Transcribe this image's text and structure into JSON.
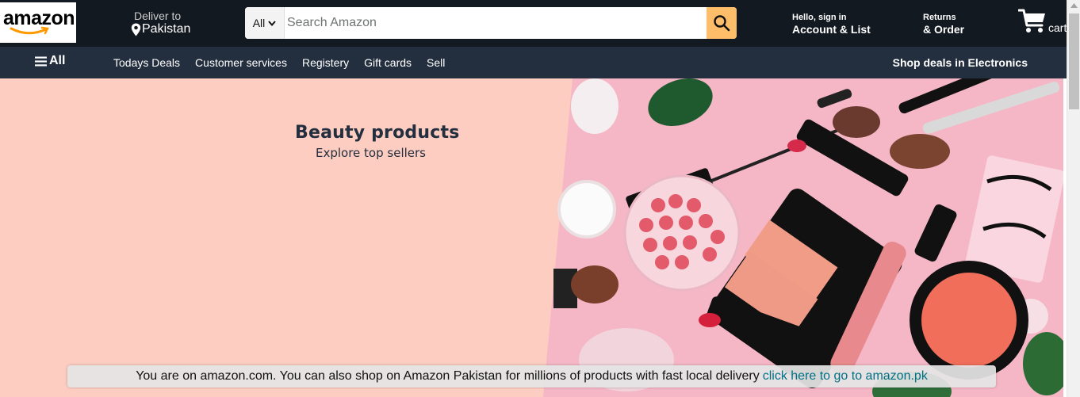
{
  "header": {
    "logo_text": "amazon",
    "deliver_to_label": "Deliver to",
    "deliver_location": "Pakistan",
    "search": {
      "category": "All",
      "placeholder": "Search Amazon"
    },
    "account": {
      "greeting": "Hello, sign in",
      "label": "Account & List"
    },
    "returns": {
      "top": "Returns",
      "bottom": "& Order"
    },
    "cart_label": "cart"
  },
  "subnav": {
    "all_label": "All",
    "links": [
      "Todays Deals",
      "Customer services",
      "Registery",
      "Gift cards",
      "Sell"
    ],
    "promo": "Shop deals in Electronics"
  },
  "hero": {
    "title": "Beauty products",
    "subtitle": "Explore top sellers"
  },
  "notice": {
    "text": "You are on amazon.com. You can also shop on Amazon Pakistan for millions of products with fast local delivery",
    "link": "click here to go to amazon.pk"
  },
  "colors": {
    "nav_dark": "#131921",
    "subnav": "#232f3e",
    "search_button": "#febd69",
    "hero_left": "#fdcdc1",
    "hero_right": "#f5b6c6",
    "link": "#007185"
  },
  "icons": [
    "location-pin-icon",
    "chevron-down-icon",
    "search-icon",
    "cart-icon",
    "hamburger-icon"
  ]
}
